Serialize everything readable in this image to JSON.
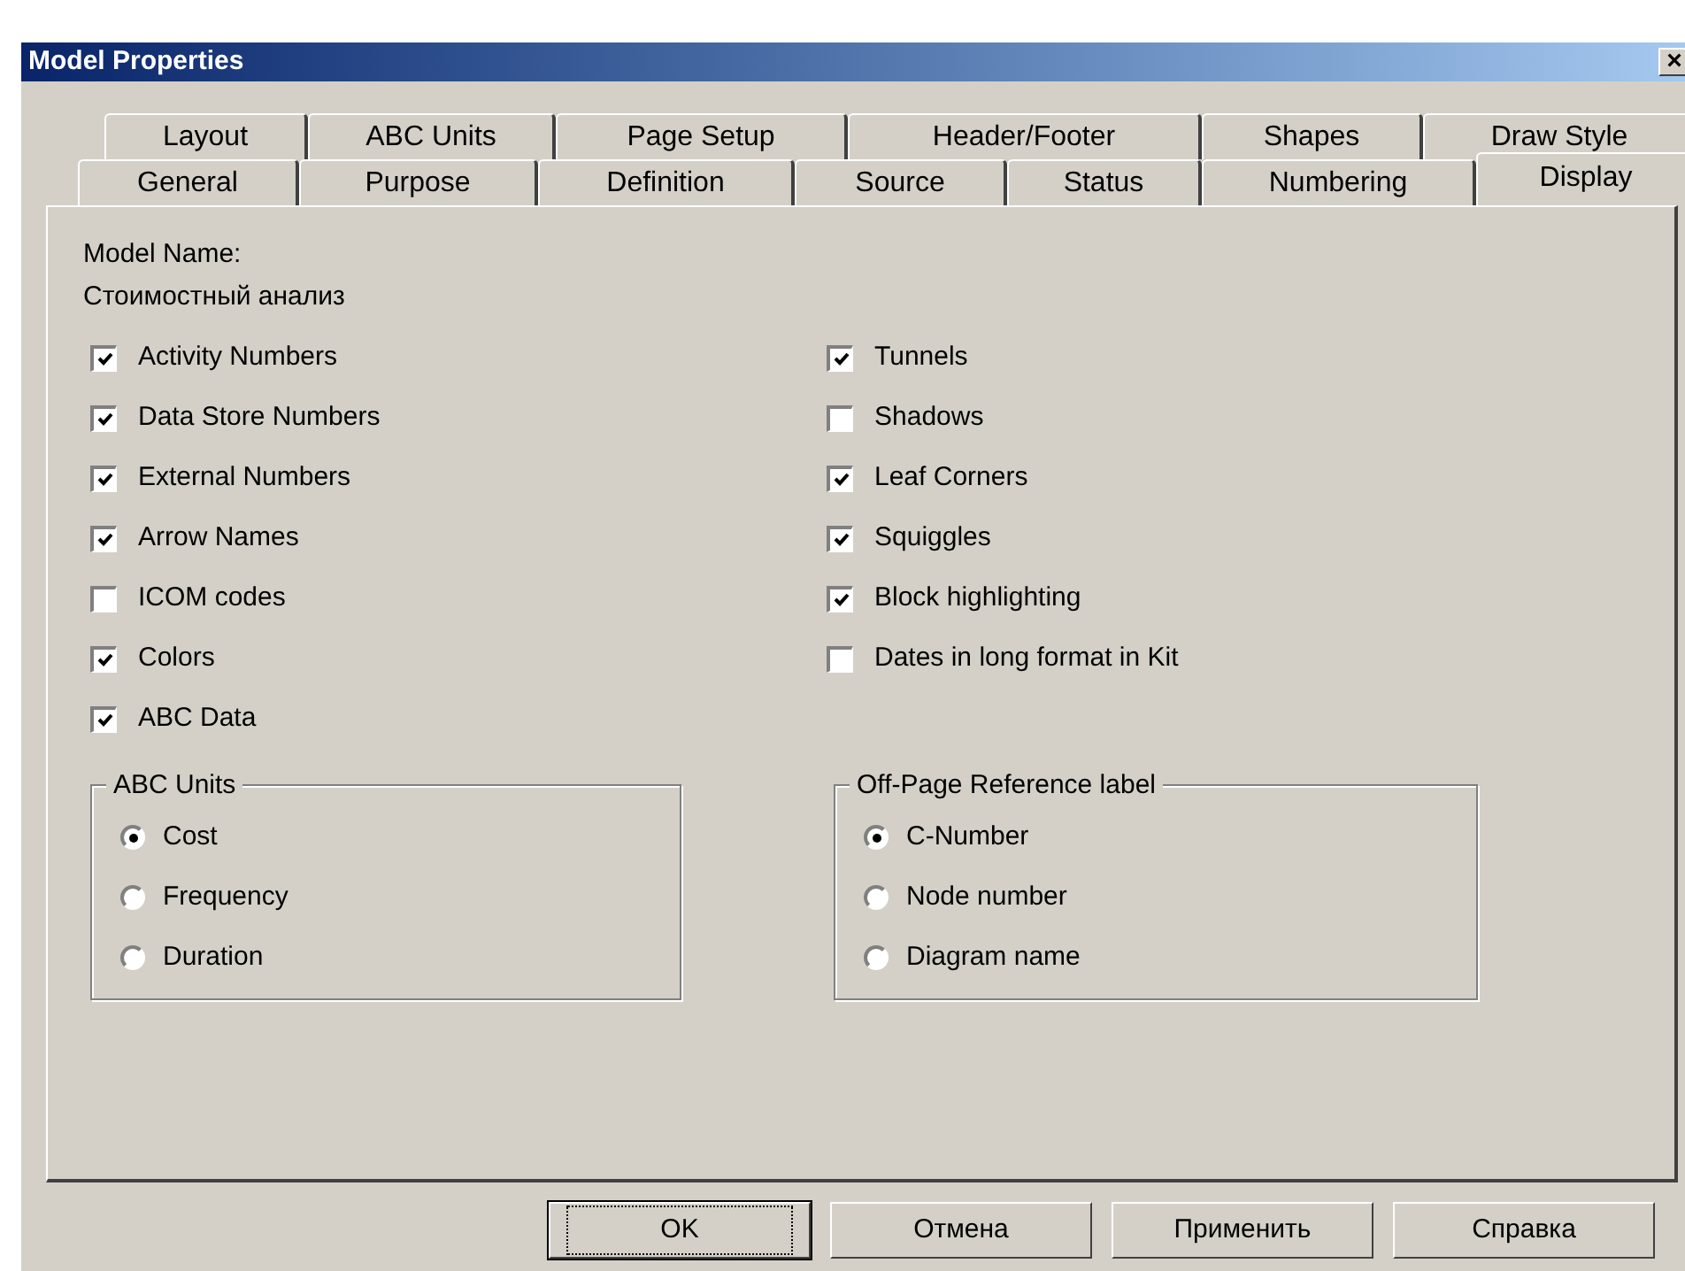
{
  "window": {
    "title": "Model Properties",
    "close": "×"
  },
  "tab_rows": [
    {
      "tabs": [
        {
          "label": "Layout",
          "selected": false
        },
        {
          "label": "ABC Units",
          "selected": false
        },
        {
          "label": "Page Setup",
          "selected": false
        },
        {
          "label": "Header/Footer",
          "selected": false
        },
        {
          "label": "Shapes",
          "selected": false
        },
        {
          "label": "Draw Style",
          "selected": false
        }
      ]
    },
    {
      "tabs": [
        {
          "label": "General",
          "selected": false
        },
        {
          "label": "Purpose",
          "selected": false
        },
        {
          "label": "Definition",
          "selected": false
        },
        {
          "label": "Source",
          "selected": false
        },
        {
          "label": "Status",
          "selected": false
        },
        {
          "label": "Numbering",
          "selected": false
        },
        {
          "label": "Display",
          "selected": true
        }
      ]
    }
  ],
  "model_name": {
    "label": "Model Name:",
    "value": "Стоимостный анализ"
  },
  "left_options": [
    {
      "label": "Activity Numbers",
      "checked": true
    },
    {
      "label": "Data Store Numbers",
      "checked": true
    },
    {
      "label": "External Numbers",
      "checked": true
    },
    {
      "label": "Arrow Names",
      "checked": true
    },
    {
      "label": "ICOM codes",
      "checked": false
    },
    {
      "label": "Colors",
      "checked": true
    },
    {
      "label": "ABC Data",
      "checked": true
    }
  ],
  "right_options": [
    {
      "label": "Tunnels",
      "checked": true
    },
    {
      "label": "Shadows",
      "checked": false
    },
    {
      "label": "Leaf Corners",
      "checked": true
    },
    {
      "label": "Squiggles",
      "checked": true
    },
    {
      "label": "Block highlighting",
      "checked": true
    },
    {
      "label": "Dates in long format in Kit",
      "checked": false
    }
  ],
  "groups": [
    {
      "title": "ABC Units",
      "options": [
        {
          "label": "Cost",
          "selected": true
        },
        {
          "label": "Frequency",
          "selected": false
        },
        {
          "label": "Duration",
          "selected": false
        }
      ]
    },
    {
      "title": "Off-Page Reference label",
      "options": [
        {
          "label": "C-Number",
          "selected": true
        },
        {
          "label": "Node number",
          "selected": false
        },
        {
          "label": "Diagram name",
          "selected": false
        }
      ]
    }
  ],
  "buttons": [
    {
      "label": "OK",
      "default": true
    },
    {
      "label": "Отмена",
      "default": false
    },
    {
      "label": "Применить",
      "default": false
    },
    {
      "label": "Справка",
      "default": false
    }
  ]
}
